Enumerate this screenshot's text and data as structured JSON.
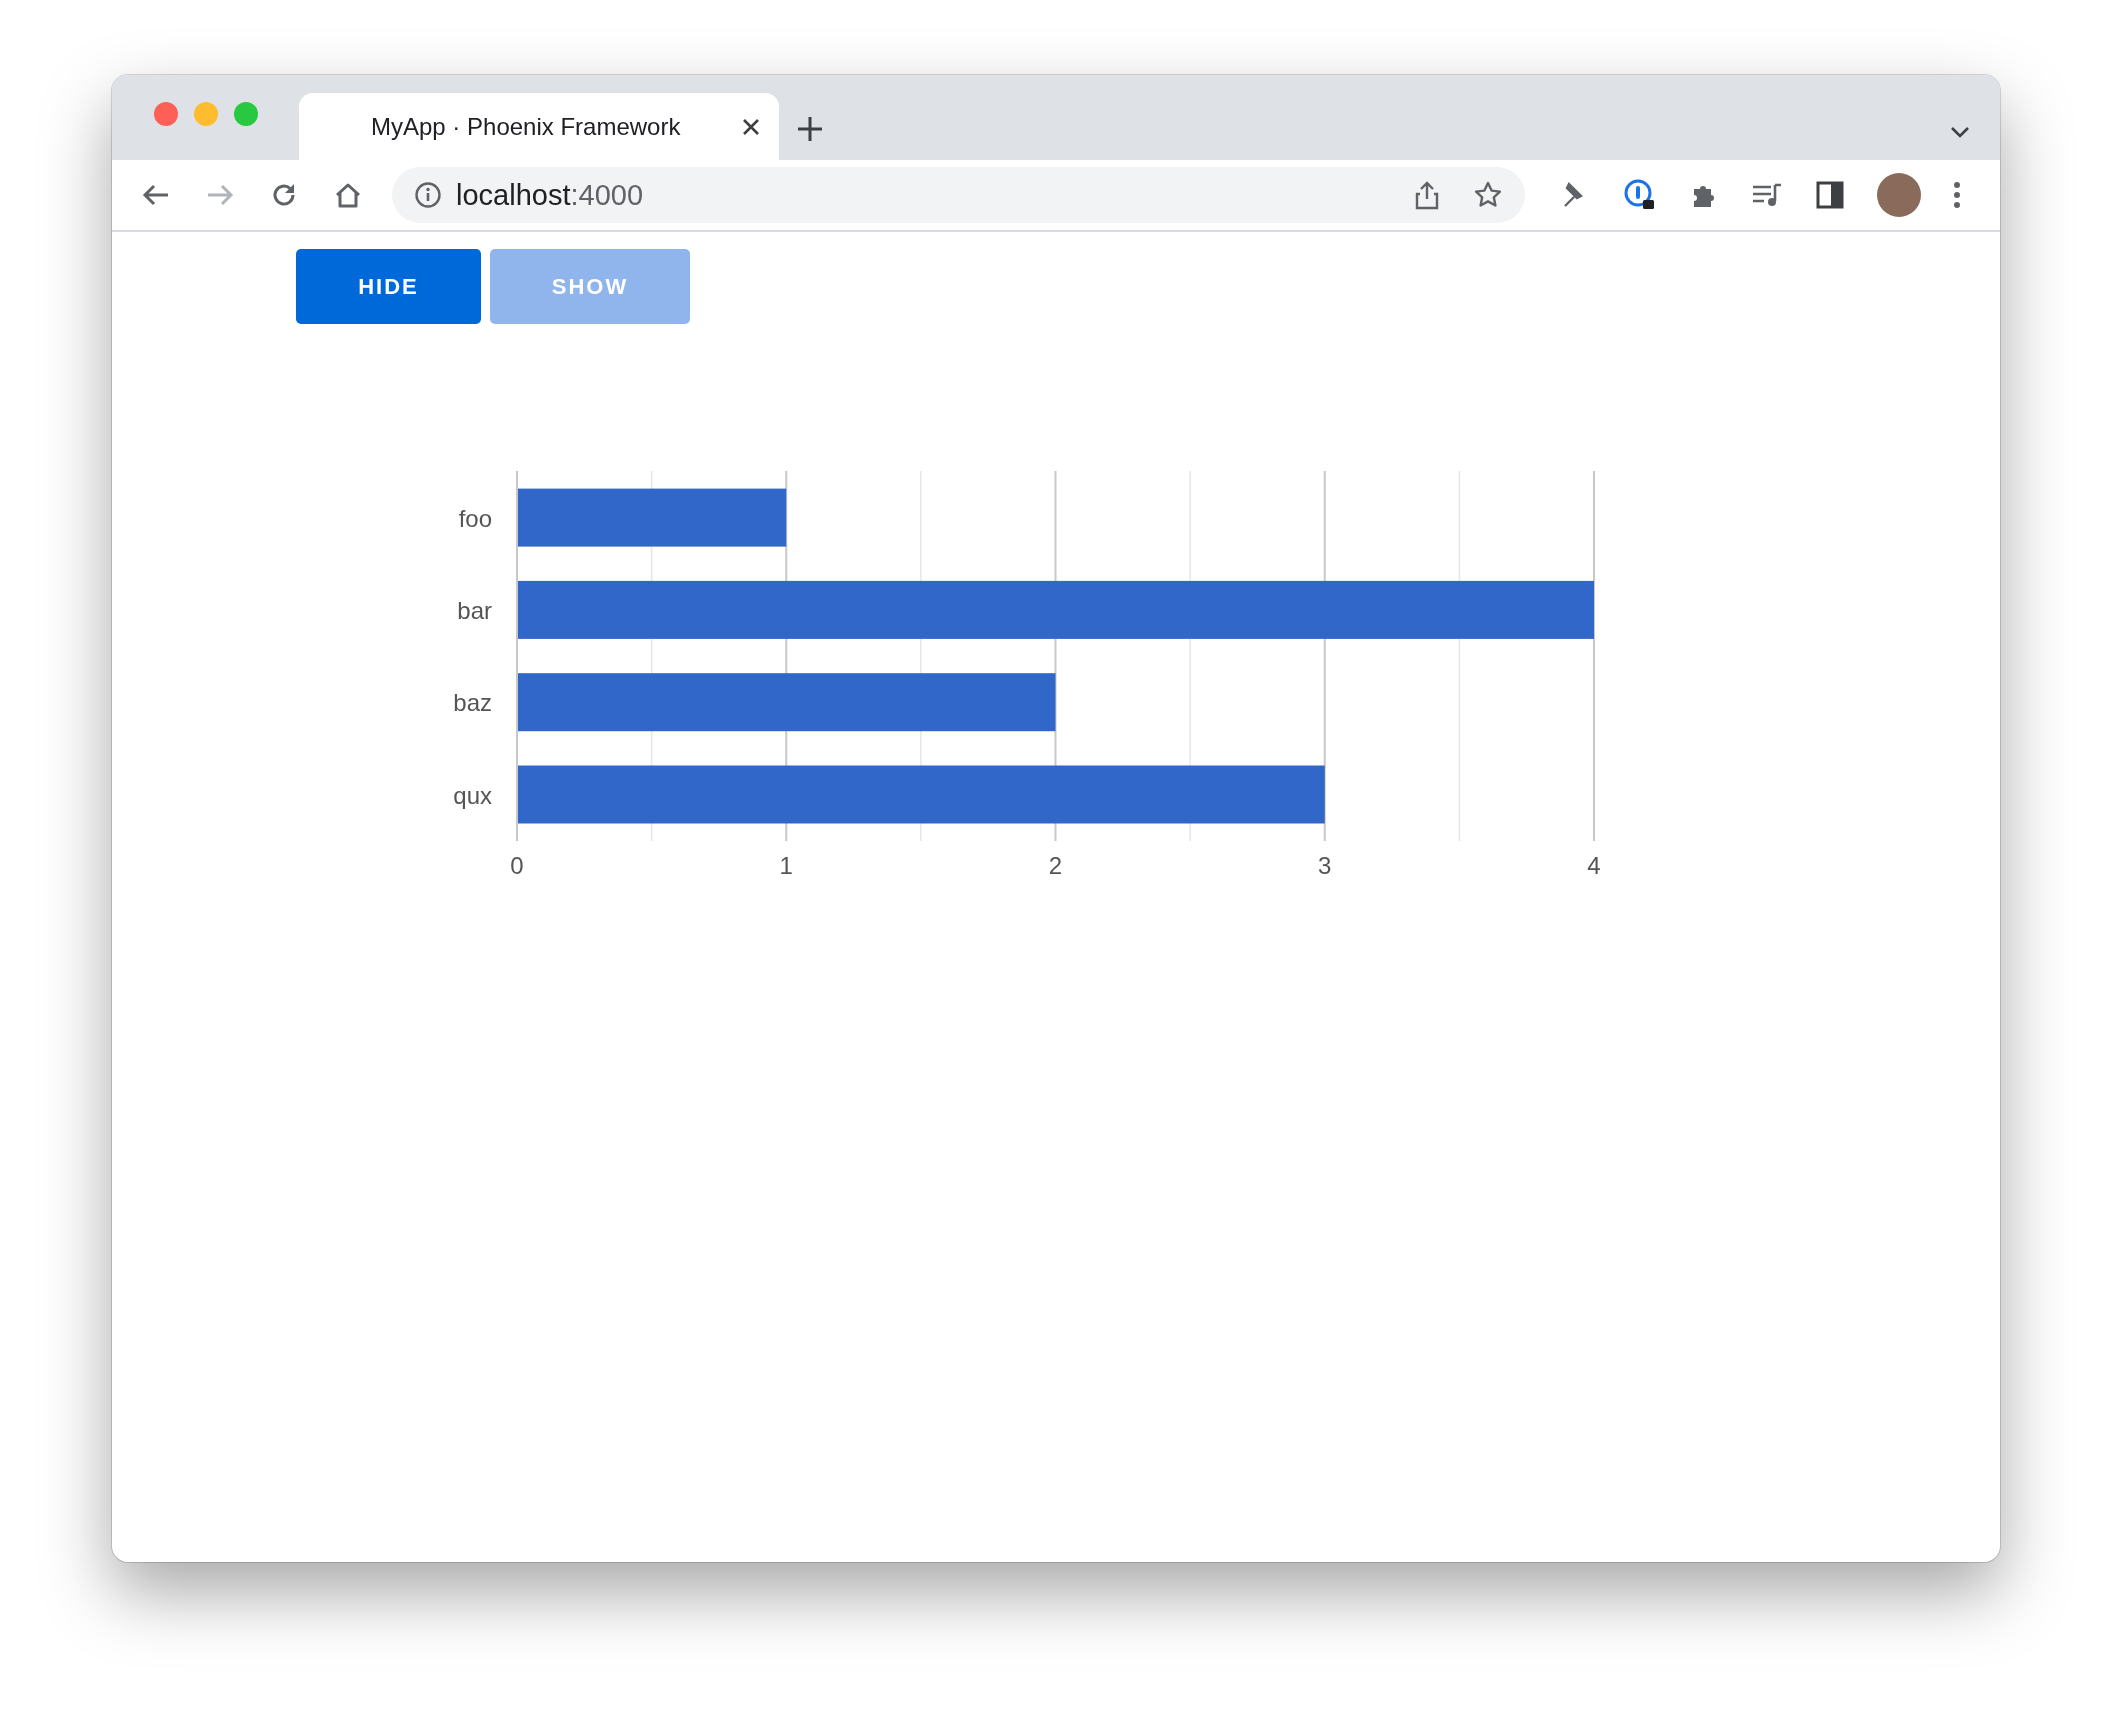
{
  "browser": {
    "tabs": [
      {
        "title": "MyApp · Phoenix Framework",
        "selected": true
      }
    ],
    "nav_buttons": [
      {
        "kind": "back",
        "disabled": false
      },
      {
        "kind": "forward",
        "disabled": true
      },
      {
        "kind": "reload",
        "disabled": false
      },
      {
        "kind": "home",
        "disabled": false
      }
    ],
    "address": {
      "host": "localhost",
      "port": ":4000"
    }
  },
  "buttons": [
    {
      "label": "HIDE",
      "disabled": false
    },
    {
      "label": "SHOW",
      "disabled": true
    }
  ],
  "chart_data": {
    "type": "bar",
    "orientation": "horizontal",
    "categories": [
      "foo",
      "bar",
      "baz",
      "qux"
    ],
    "values": [
      1,
      4,
      2,
      3
    ],
    "xlim": [
      0,
      4
    ],
    "xticks": [
      0,
      1,
      2,
      3,
      4
    ],
    "grid": true
  }
}
